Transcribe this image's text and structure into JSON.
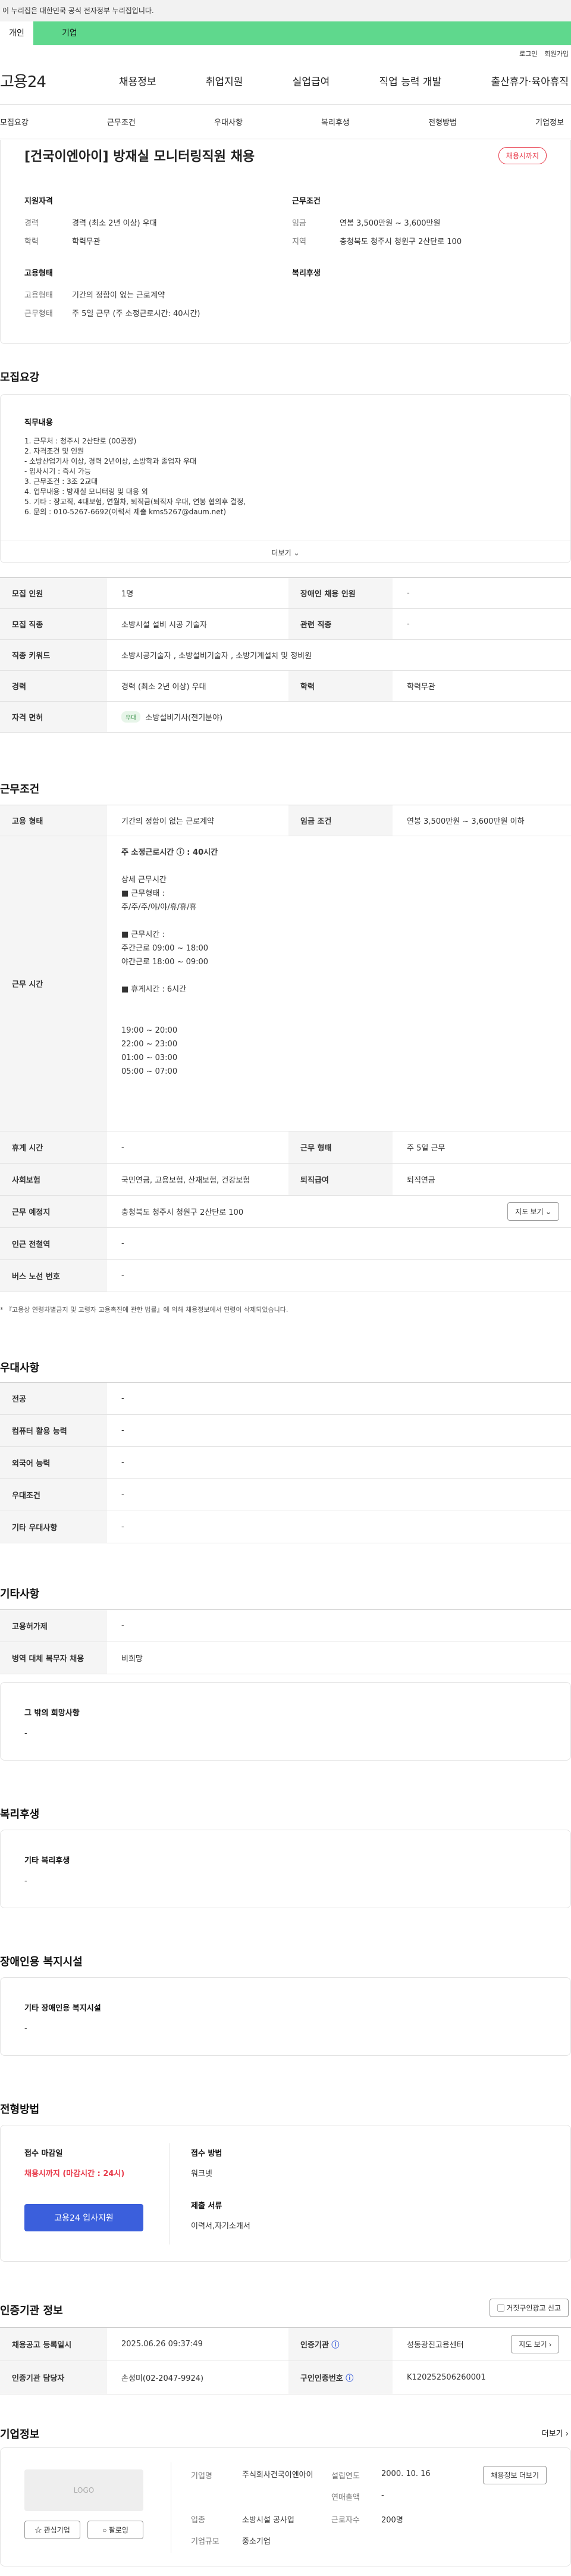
{
  "top_notice": "이 누리집은 대한민국 공식 전자정부 누리집입니다.",
  "tabs": [
    "개인",
    "기업"
  ],
  "util_links": [
    "로그인",
    "회원가입"
  ],
  "logo": "고용24",
  "gnb": [
    "채용정보",
    "취업지원",
    "실업급여",
    "직업 능력 개발",
    "출산휴가·육아휴직"
  ],
  "anchor_nav": [
    "모집요강",
    "근무조건",
    "우대사항",
    "복리후생",
    "전형방법",
    "기업정보"
  ],
  "job": {
    "title": "[건국이엔아이] 방재실 모니터링직원 채용",
    "status": "채용시까지",
    "req_heading": "지원자격",
    "career_k": "경력",
    "career_v": "경력 (최소 2년 이상) 우대",
    "edu_k": "학력",
    "edu_v": "학력무관",
    "cond_heading": "근무조건",
    "wage_k": "임금",
    "wage_v": "연봉 3,500만원 ~ 3,600만원",
    "area_k": "지역",
    "area_v": "충청북도 청주시 청원구 2산단로 100",
    "emp_heading": "고용형태",
    "emptype_k": "고용형태",
    "emptype_v": "기간의 정함이 없는 근로계약",
    "worktype_k": "근무형태",
    "worktype_v": "주 5일 근무 (주 소정근로시간: 40시간)",
    "welfare_heading": "복리후생"
  },
  "recruit": {
    "heading": "모집요강",
    "detail_heading": "직무내용",
    "lines": [
      "1. 근무처 : 청주시 2산단로 (00공장)",
      "2. 자격조건 및 인원",
      "- 소방산업기사 이상, 경력 2년이상, 소방학과 졸업자 우대",
      "- 입사시기 : 즉시 가능",
      "3. 근무조건 : 3조 2교대",
      "4. 업무내용 : 방재실 모니터링 및 대응 외",
      "5. 기타 : 장교직, 4대보험, 연월차, 퇴직금(퇴직자 우대, 연봉 협의후 결정,",
      "6. 문의 : 010-5267-6692(이력서 제출 kms5267@daum.net)"
    ],
    "more": "더보기",
    "rows": [
      {
        "k1": "모집 인원",
        "v1": "1명",
        "k2": "장애인 채용 인원",
        "v2": "-"
      },
      {
        "k1": "모집 직종",
        "v1": "소방시설 설비 시공 기술자",
        "k2": "관련 직종",
        "v2": "-"
      },
      {
        "k1": "직종 키워드",
        "v1": "소방시공기술자 , 소방설비기술자 , 소방기계설치 및 정비원"
      },
      {
        "k1": "경력",
        "v1": "경력 (최소 2년 이상) 우대",
        "k2": "학력",
        "v2": "학력무관"
      },
      {
        "k1": "자격 면허",
        "tag": "우대",
        "v1": "소방설비기사(전기분야)"
      }
    ]
  },
  "workcond": {
    "heading": "근무조건",
    "emp_k": "고용 형태",
    "emp_v": "기간의 정함이 없는 근로계약",
    "wage_k": "임금 조건",
    "wage_v": "연봉 3,500만원 ~ 3,600만원 이하",
    "time_k": "근무 시간",
    "time_lines": [
      "주 소정근로시간 ⓘ : 40시간",
      "",
      "상세 근무시간",
      "■ 근무형태 :",
      "주/주/주/야/야/휴/휴/휴",
      "",
      "■ 근무시간 :",
      "주간근로 09:00 ~ 18:00",
      "야간근로 18:00 ~ 09:00",
      "",
      "■ 휴게시간 : 6시간",
      "",
      "",
      "19:00 ~ 20:00",
      "22:00 ~ 23:00",
      "01:00 ~ 03:00",
      "05:00 ~ 07:00"
    ],
    "rest_k": "휴게 시간",
    "rest_v": "-",
    "shift_k": "근무 형태",
    "shift_v": "주 5일 근무",
    "ins_k": "사회보험",
    "ins_v": "국민연금, 고용보험, 산재보험, 건강보험",
    "sev_k": "퇴직급여",
    "sev_v": "퇴직연금",
    "place_k": "근무 예정지",
    "place_v": "충청북도 청주시 청원구 2산단로 100",
    "map_btn": "지도 보기",
    "subway_k": "인근 전철역",
    "subway_v": "-",
    "bus_k": "버스 노선 번호",
    "bus_v": "-",
    "note": "* 『고용상 연령차별금지 및 고령자 고용촉진에 관한 법률』에 의해 채용정보에서 연령이 삭제되었습니다."
  },
  "pref": {
    "heading": "우대사항",
    "rows": [
      {
        "k": "전공",
        "v": "-"
      },
      {
        "k": "컴퓨터 활용 능력",
        "v": "-"
      },
      {
        "k": "외국어 능력",
        "v": "-"
      },
      {
        "k": "우대조건",
        "v": "-"
      },
      {
        "k": "기타 우대사항",
        "v": "-"
      }
    ]
  },
  "etc": {
    "heading": "기타사항",
    "rows": [
      {
        "k": "고용허가제",
        "v": "-"
      },
      {
        "k": "병역 대체 복무자 채용",
        "v": "비희망"
      }
    ],
    "wish_heading": "그 밖의 희망사항",
    "wish_v": "-"
  },
  "welfare": {
    "heading": "복리후생",
    "sub": "기타 복리후생",
    "v": "-"
  },
  "disabled": {
    "heading": "장애인용 복지시설",
    "sub": "기타 장애인용 복지시설",
    "v": "-"
  },
  "screening": {
    "heading": "전형방법",
    "deadline_k": "접수 마감일",
    "deadline_v": "채용시까지 (마감시간 : 24시)",
    "apply_btn": "고용24 입사지원",
    "method_k": "접수 방법",
    "method_v": "워크넷",
    "docs_k": "제출 서류",
    "docs_v": "이력서,자기소개서"
  },
  "cert": {
    "heading": "인증기관 정보",
    "btn": "거짓구인광고 신고",
    "reg_k": "채용공고 등록일시",
    "reg_v": "2025.06.26 09:37:49",
    "inst_k": "인증기관",
    "inst_v": "성동광진고용센터",
    "inst_btn": "지도 보기",
    "mgr_k": "인증기관 담당자",
    "mgr_v": "손성미(02-2047-9924)",
    "no_k": "구인인증번호",
    "no_v": "K120252506260001"
  },
  "company": {
    "heading": "기업정보",
    "more": "더보기",
    "logo": "LOGO",
    "fav_btn": "관심기업",
    "follow_btn": "팔로잉",
    "name_k": "기업명",
    "name_v": "주식회사건국이엔아이",
    "found_k": "설립연도",
    "found_v": "2000. 10. 16",
    "sales_k": "연매출액",
    "sales_v": "-",
    "industry_k": "업종",
    "industry_v": "소방시설 공사업",
    "staff_k": "근로자수",
    "staff_v": "200명",
    "size_k": "기업규모",
    "size_v": "중소기업",
    "view_btn": "채용정보 더보기"
  }
}
